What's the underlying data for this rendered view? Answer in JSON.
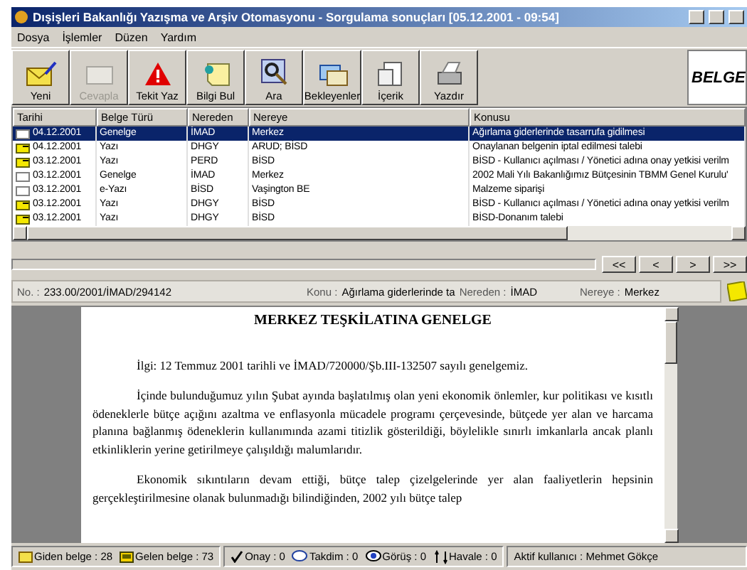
{
  "window": {
    "title": "Dışişleri Bakanlığı Yazışma ve Arşiv Otomasyonu - Sorgulama sonuçları [05.12.2001 - 09:54]"
  },
  "menu": [
    "Dosya",
    "İşlemler",
    "Düzen",
    "Yardım"
  ],
  "toolbar": [
    {
      "label": "Yeni",
      "kind": "mail",
      "disabled": false
    },
    {
      "label": "Cevapla",
      "kind": "reply",
      "disabled": true
    },
    {
      "label": "Tekit Yaz",
      "kind": "warning",
      "disabled": false
    },
    {
      "label": "Bilgi Bul",
      "kind": "note",
      "disabled": false
    },
    {
      "label": "Ara",
      "kind": "search",
      "disabled": false
    },
    {
      "label": "Bekleyenler",
      "kind": "queue",
      "disabled": false
    },
    {
      "label": "İçerik",
      "kind": "content",
      "disabled": false
    },
    {
      "label": "Yazdır",
      "kind": "print",
      "disabled": false
    }
  ],
  "logo": {
    "text": "BELGE"
  },
  "table": {
    "columns": [
      "Tarihi",
      "Belge Türü",
      "Nereden",
      "Nereye",
      "Konusu"
    ],
    "rows": [
      {
        "kind": "plain",
        "selected": true,
        "cells": [
          "04.12.2001",
          "Genelge",
          "İMAD",
          "Merkez",
          "Ağırlama giderlerinde tasarrufa gidilmesi"
        ]
      },
      {
        "kind": "yellow",
        "selected": false,
        "cells": [
          "04.12.2001",
          "Yazı",
          "DHGY",
          "ARUD; BİSD",
          "Onaylanan belgenin iptal edilmesi talebi"
        ]
      },
      {
        "kind": "yellow",
        "selected": false,
        "cells": [
          "03.12.2001",
          "Yazı",
          "PERD",
          "BİSD",
          "BİSD - Kullanıcı açılması / Yönetici adına onay yetkisi verilm"
        ]
      },
      {
        "kind": "plain",
        "selected": false,
        "cells": [
          "03.12.2001",
          "Genelge",
          "İMAD",
          "Merkez",
          "2002 Mali Yılı Bakanlığımız Bütçesinin TBMM Genel Kurulu'"
        ]
      },
      {
        "kind": "plain",
        "selected": false,
        "cells": [
          "03.12.2001",
          "e-Yazı",
          "BİSD",
          "Vaşington BE",
          "Malzeme siparişi"
        ]
      },
      {
        "kind": "yellow",
        "selected": false,
        "cells": [
          "03.12.2001",
          "Yazı",
          "DHGY",
          "BİSD",
          "BİSD - Kullanıcı açılması / Yönetici adına onay yetkisi verilm"
        ]
      },
      {
        "kind": "yellow",
        "selected": false,
        "cells": [
          "03.12.2001",
          "Yazı",
          "DHGY",
          "BİSD",
          "BİSD-Donanım talebi"
        ]
      }
    ]
  },
  "navigation": [
    "<<",
    "<",
    ">",
    ">>"
  ],
  "info": [
    {
      "label": "No. :",
      "value": "233.00/2001/İMAD/294142"
    },
    {
      "label": "Konu :",
      "value": "Ağırlama giderlerinde ta"
    },
    {
      "label": "Nereden :",
      "value": "İMAD"
    },
    {
      "label": "Nereye :",
      "value": "Merkez"
    }
  ],
  "document": {
    "title": "MERKEZ TEŞKİLATINA GENELGE",
    "reference": "İlgi: 12 Temmuz 2001 tarihli ve İMAD/720000/Şb.III-132507 sayılı genelgemiz.",
    "paragraphs": [
      "İçinde bulunduğumuz yılın Şubat ayında başlatılmış olan yeni ekonomik önlemler, kur politikası ve kısıtlı ödeneklerle bütçe açığını azaltma ve enflasyonla mücadele programı çerçevesinde, bütçede yer alan ve  harcama planına bağlanmış ödeneklerin kullanımında azami titizlik gösterildiği, böylelikle sınırlı imkanlarla ancak planlı etkinliklerin yerine getirilmeye çalışıldığı malumlarıdır.",
      "Ekonomik sıkıntıların devam ettiği, bütçe talep çizelgelerinde yer alan faaliyetlerin hepsinin gerçekleştirilmesine olanak bulunmadığı bilindiğinden, 2002 yılı bütçe talep"
    ]
  },
  "status": [
    {
      "kind": "outgoing",
      "text": "Giden belge : 28"
    },
    {
      "kind": "incoming",
      "text": "Gelen belge : 73"
    },
    {
      "kind": "check",
      "text": "Onay : 0"
    },
    {
      "kind": "submit",
      "text": "Takdim : 0"
    },
    {
      "kind": "opinion",
      "text": "Görüş : 0"
    },
    {
      "kind": "transfer",
      "text": "Havale : 0"
    },
    {
      "text": "Aktif kullanıcı : Mehmet Gökçe"
    }
  ]
}
